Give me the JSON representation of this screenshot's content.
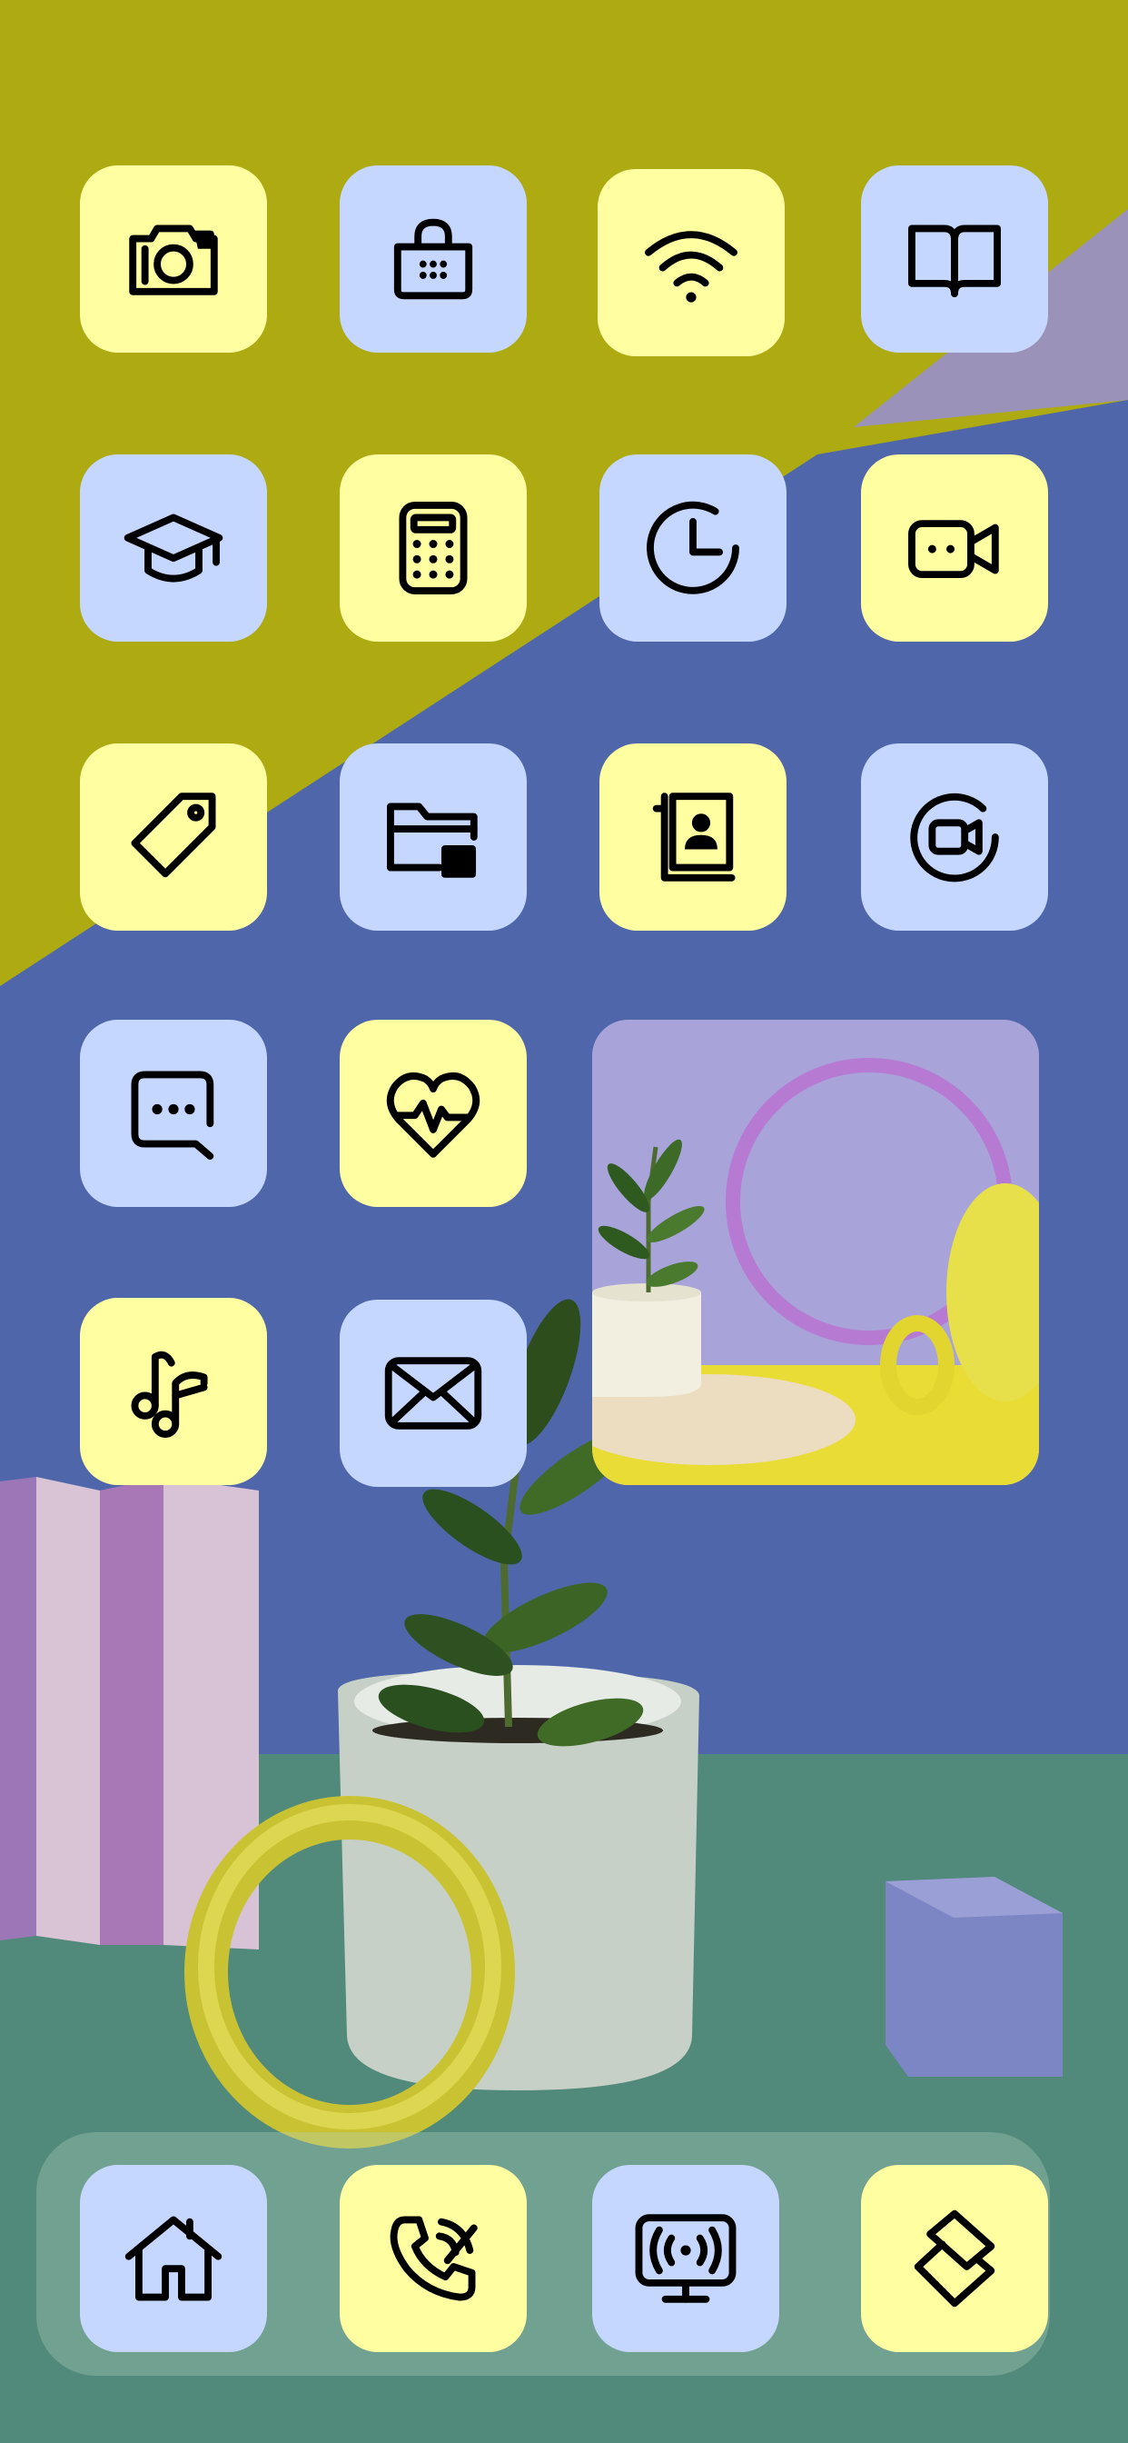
{
  "screen": {
    "type": "ios-home-screen",
    "wallpaper_colors": {
      "olive": "#adaa12",
      "blue": "#4f67aa",
      "lavender": "#9b92b9",
      "green": "#51897a"
    }
  },
  "icon_colors": {
    "yellow": "#ffffa1",
    "blue": "#c6d7ff"
  },
  "apps": [
    {
      "icon": "camera-icon",
      "color": "yellow"
    },
    {
      "icon": "shopping-bag-icon",
      "color": "blue"
    },
    {
      "icon": "wifi-icon",
      "color": "yellow"
    },
    {
      "icon": "book-open-icon",
      "color": "blue"
    },
    {
      "icon": "graduation-cap-icon",
      "color": "blue"
    },
    {
      "icon": "calculator-icon",
      "color": "yellow"
    },
    {
      "icon": "clock-icon",
      "color": "blue"
    },
    {
      "icon": "video-camera-icon",
      "color": "yellow"
    },
    {
      "icon": "tag-icon",
      "color": "yellow"
    },
    {
      "icon": "folder-icon",
      "color": "blue"
    },
    {
      "icon": "contacts-book-icon",
      "color": "yellow"
    },
    {
      "icon": "video-call-circle-icon",
      "color": "blue"
    },
    {
      "icon": "message-dots-icon",
      "color": "blue"
    },
    {
      "icon": "heart-pulse-icon",
      "color": "yellow"
    },
    {
      "icon": "music-notes-icon",
      "color": "yellow"
    },
    {
      "icon": "mail-icon",
      "color": "blue"
    }
  ],
  "photo_widget": {
    "content": "plant-pot-with-ring-photo"
  },
  "dock": {
    "apps": [
      {
        "icon": "home-icon",
        "color": "blue"
      },
      {
        "icon": "phone-call-icon",
        "color": "yellow"
      },
      {
        "icon": "broadcast-monitor-icon",
        "color": "blue"
      },
      {
        "icon": "shortcuts-icon",
        "color": "yellow"
      }
    ]
  }
}
